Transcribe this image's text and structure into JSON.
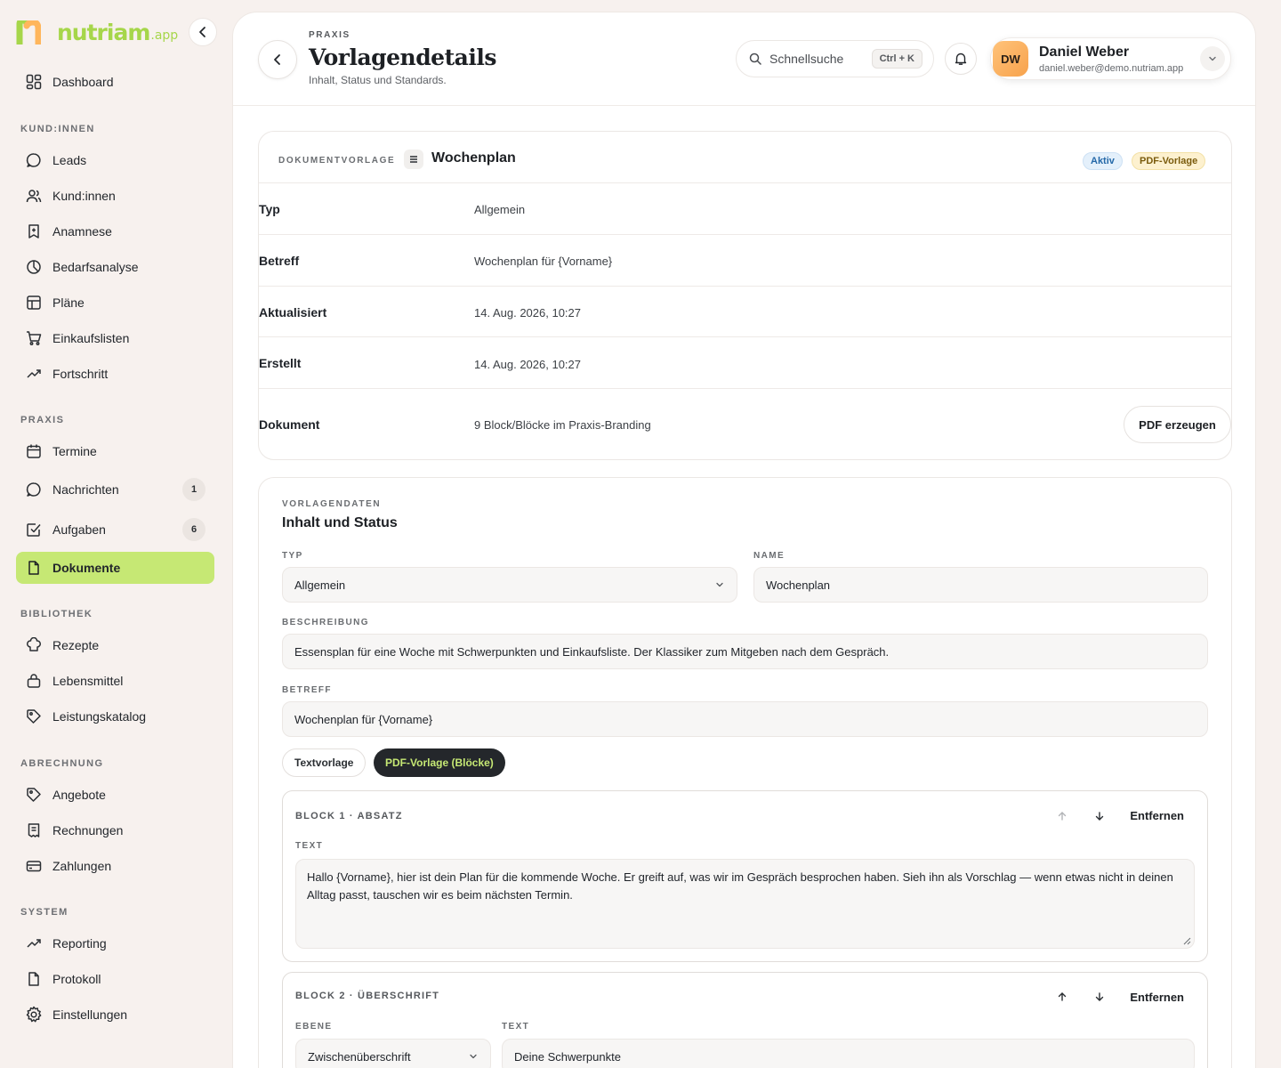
{
  "brand": {
    "name": "nutriam",
    "tld": ".app",
    "color": "#a6d64a"
  },
  "sidebar": {
    "dashboard": {
      "label": "Dashboard",
      "icon": "dashboard-icon"
    },
    "sections": {
      "kunden": "KUND:INNEN",
      "praxis": "PRAXIS",
      "bibliothek": "BIBLIOTHEK",
      "abrechnung": "ABRECHNUNG",
      "system": "SYSTEM"
    },
    "kunden_items": [
      {
        "label": "Leads",
        "icon": "chat-bubble-icon"
      },
      {
        "label": "Kund:innen",
        "icon": "users-icon"
      },
      {
        "label": "Anamnese",
        "icon": "bookmark-doc-icon"
      },
      {
        "label": "Bedarfsanalyse",
        "icon": "clock-chart-icon"
      },
      {
        "label": "Pläne",
        "icon": "grid-table-icon"
      },
      {
        "label": "Einkaufslisten",
        "icon": "cart-icon"
      },
      {
        "label": "Fortschritt",
        "icon": "trend-up-icon"
      }
    ],
    "praxis_items": [
      {
        "label": "Termine",
        "icon": "calendar-icon"
      },
      {
        "label": "Nachrichten",
        "icon": "message-icon",
        "badge": "1"
      },
      {
        "label": "Aufgaben",
        "icon": "checkbox-icon",
        "badge": "6"
      },
      {
        "label": "Dokumente",
        "icon": "document-icon",
        "active": true
      }
    ],
    "bibliothek_items": [
      {
        "label": "Rezepte",
        "icon": "chef-hat-icon"
      },
      {
        "label": "Lebensmittel",
        "icon": "basket-icon"
      },
      {
        "label": "Leistungskatalog",
        "icon": "tag-icon"
      }
    ],
    "abrechnung_items": [
      {
        "label": "Angebote",
        "icon": "tag-icon"
      },
      {
        "label": "Rechnungen",
        "icon": "receipt-icon"
      },
      {
        "label": "Zahlungen",
        "icon": "credit-card-icon"
      }
    ],
    "system_items": [
      {
        "label": "Reporting",
        "icon": "trend-up-icon"
      },
      {
        "label": "Protokoll",
        "icon": "document-icon"
      },
      {
        "label": "Einstellungen",
        "icon": "gear-icon"
      }
    ],
    "active_color": "#c6e874"
  },
  "header": {
    "breadcrumb": "PRAXIS",
    "title": "Vorlagendetails",
    "subtitle": "Inhalt, Status und Standards.",
    "search_placeholder": "Schnellsuche",
    "search_shortcut": "Ctrl + K",
    "user": {
      "initials": "DW",
      "name": "Daniel Weber",
      "email": "daniel.weber@demo.nutriam.app"
    }
  },
  "detail": {
    "label": "DOKUMENTVORLAGE",
    "title": "Wochenplan",
    "badges": {
      "status": "Aktiv",
      "kind": "PDF-Vorlage"
    },
    "rows": [
      {
        "key": "Typ",
        "value": "Allgemein"
      },
      {
        "key": "Betreff",
        "value": "Wochenplan für {Vorname}"
      },
      {
        "key": "Aktualisiert",
        "value": "14. Aug. 2026, 10:27"
      },
      {
        "key": "Erstellt",
        "value": "14. Aug. 2026, 10:27"
      },
      {
        "key": "Dokument",
        "value": "9 Block/Blöcke im Praxis-Branding"
      }
    ],
    "pdf_button": "PDF erzeugen"
  },
  "form": {
    "eyebrow": "VORLAGENDATEN",
    "title": "Inhalt und Status",
    "typ": {
      "label": "TYP",
      "value": "Allgemein"
    },
    "name": {
      "label": "NAME",
      "value": "Wochenplan"
    },
    "beschreibung": {
      "label": "BESCHREIBUNG",
      "value": "Essensplan für eine Woche mit Schwerpunkten und Einkaufsliste. Der Klassiker zum Mitgeben nach dem Gespräch."
    },
    "betreff": {
      "label": "BETREFF",
      "value": "Wochenplan für {Vorname}"
    },
    "modes": {
      "text": "Textvorlage",
      "pdf": "PDF-Vorlage (Blöcke)"
    },
    "blocks": [
      {
        "title": "BLOCK 1 · ABSATZ",
        "remove": "Entfernen",
        "text_label": "TEXT",
        "text": "Hallo {Vorname}, hier ist dein Plan für die kommende Woche. Er greift auf, was wir im Gespräch besprochen haben. Sieh ihn als Vorschlag — wenn etwas nicht in deinen Alltag passt, tauschen wir es beim nächsten Termin."
      },
      {
        "title": "BLOCK 2 · ÜBERSCHRIFT",
        "remove": "Entfernen",
        "level_label": "EBENE",
        "level": "Zwischenüberschrift",
        "text_label": "TEXT",
        "text": "Deine Schwerpunkte"
      }
    ]
  }
}
